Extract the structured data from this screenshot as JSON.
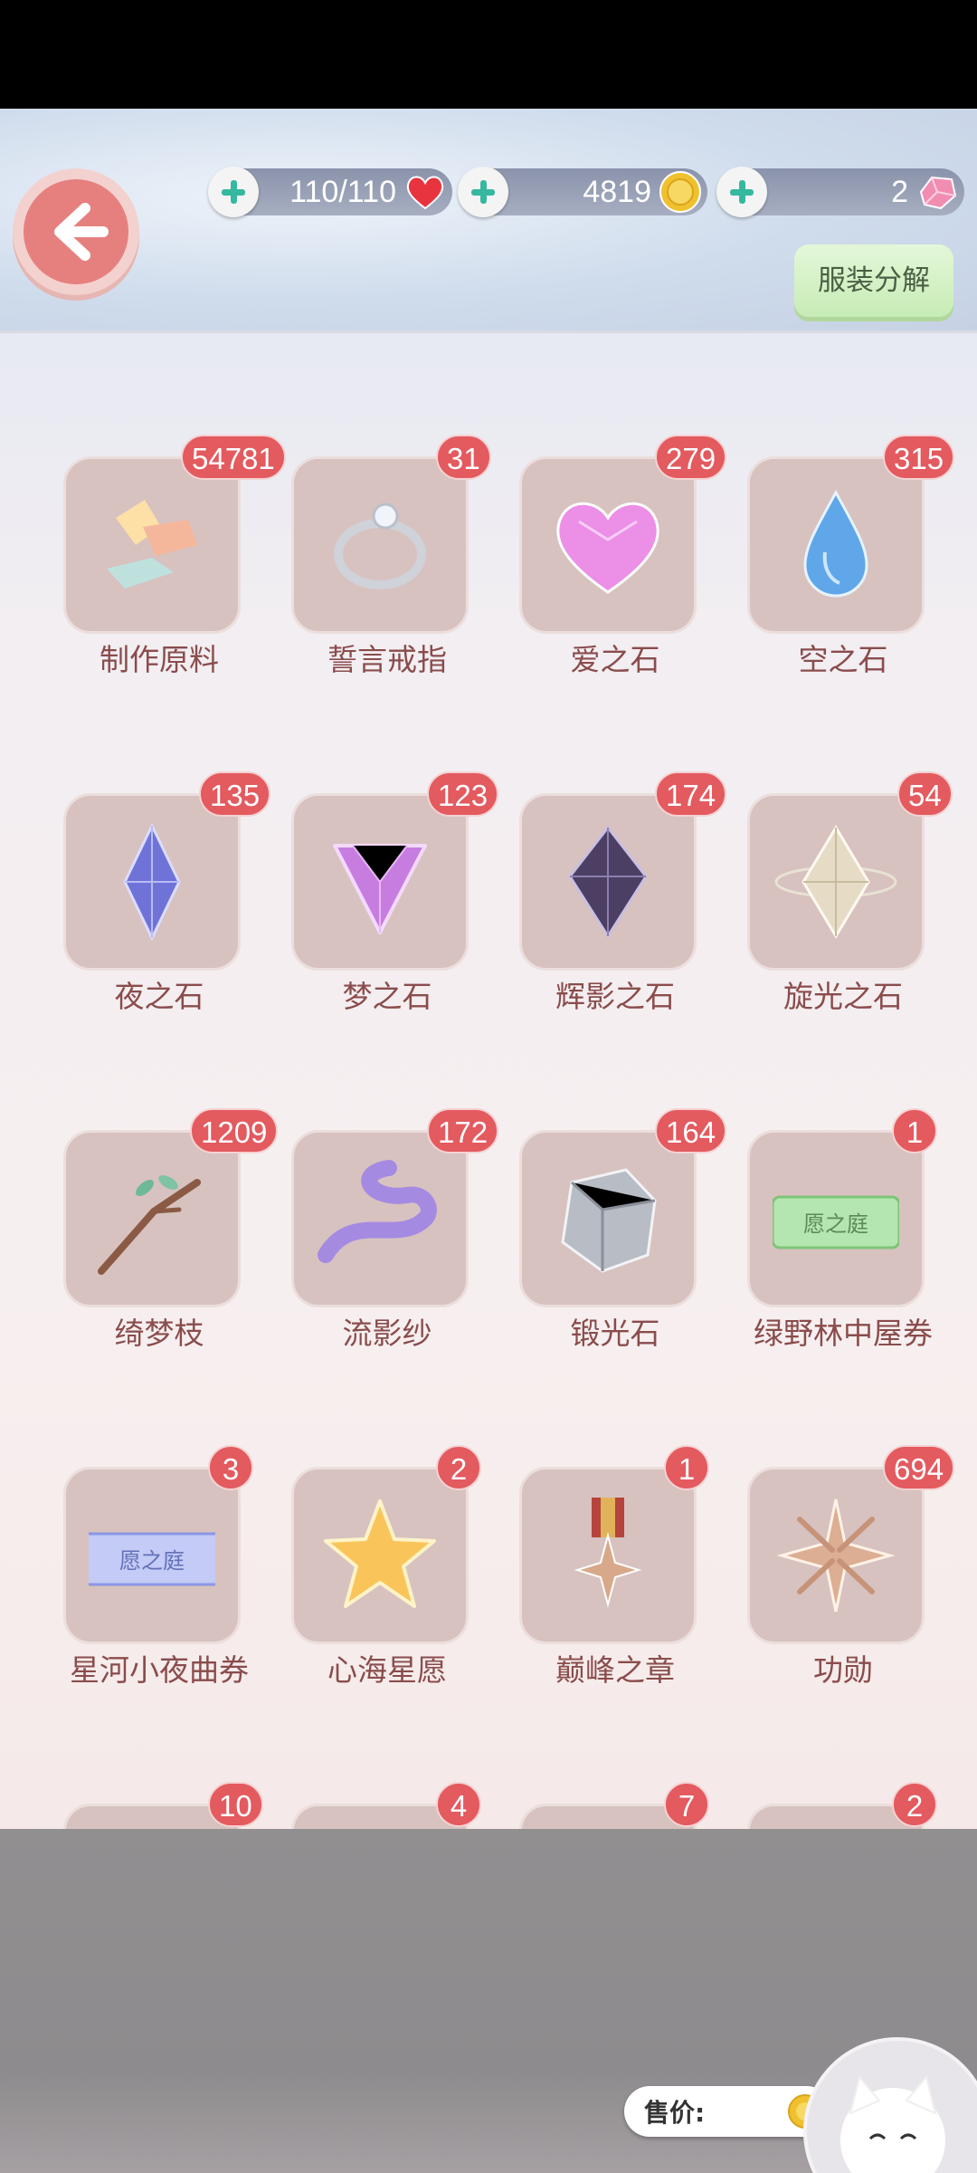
{
  "header": {
    "stamina": "110/110",
    "gold": "4819",
    "diamonds": "2",
    "disassemble_label": "服装分解"
  },
  "items": [
    {
      "name": "制作原料",
      "count": "54781",
      "icon": "fabric-scraps-icon"
    },
    {
      "name": "誓言戒指",
      "count": "31",
      "icon": "ring-icon"
    },
    {
      "name": "爱之石",
      "count": "279",
      "icon": "heart-gem-icon"
    },
    {
      "name": "空之石",
      "count": "315",
      "icon": "blue-drop-gem-icon"
    },
    {
      "name": "夜之石",
      "count": "135",
      "icon": "night-crystal-icon"
    },
    {
      "name": "梦之石",
      "count": "123",
      "icon": "dream-gem-icon"
    },
    {
      "name": "辉影之石",
      "count": "174",
      "icon": "shadow-crystal-icon"
    },
    {
      "name": "旋光之石",
      "count": "54",
      "icon": "orbit-crystal-icon"
    },
    {
      "name": "绮梦枝",
      "count": "1209",
      "icon": "branch-icon"
    },
    {
      "name": "流影纱",
      "count": "172",
      "icon": "ribbon-icon"
    },
    {
      "name": "锻光石",
      "count": "164",
      "icon": "silver-ore-icon"
    },
    {
      "name": "绿野林中屋券",
      "count": "1",
      "icon": "green-ticket-icon",
      "ticket_text": "愿之庭"
    },
    {
      "name": "星河小夜曲券",
      "count": "3",
      "icon": "blue-ticket-icon",
      "ticket_text": "愿之庭"
    },
    {
      "name": "心海星愿",
      "count": "2",
      "icon": "star-icon"
    },
    {
      "name": "巅峰之章",
      "count": "1",
      "icon": "medal-icon"
    },
    {
      "name": "功勋",
      "count": "694",
      "icon": "merit-star-icon"
    },
    {
      "name": "",
      "count": "10",
      "icon": "partial-item-icon"
    },
    {
      "name": "",
      "count": "4",
      "icon": "partial-item-icon"
    },
    {
      "name": "",
      "count": "7",
      "icon": "partial-item-icon"
    },
    {
      "name": "",
      "count": "2",
      "icon": "partial-item-icon"
    }
  ],
  "sell": {
    "price_label": "售价:"
  }
}
